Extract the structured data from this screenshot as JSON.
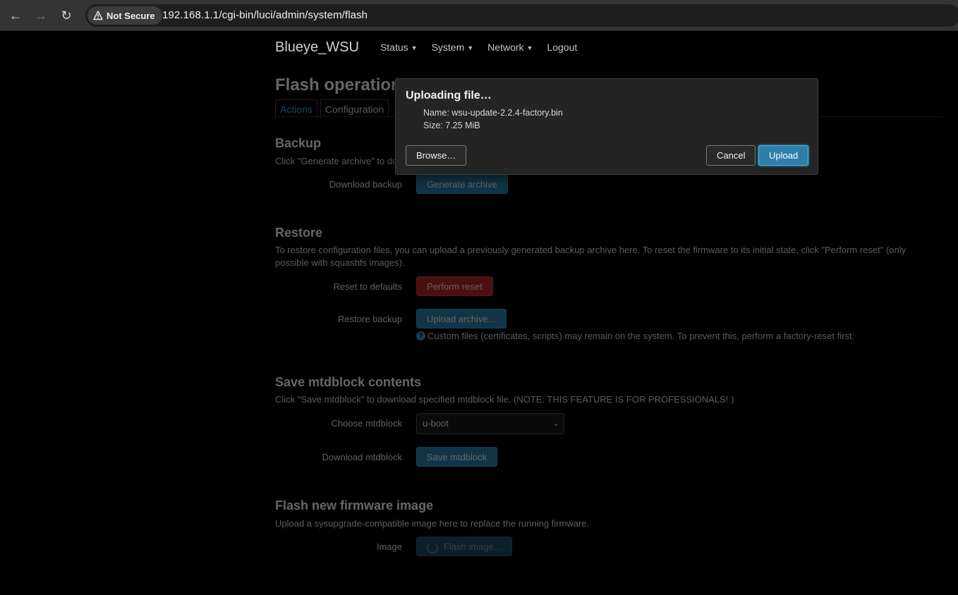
{
  "browser": {
    "security_label": "Not Secure",
    "url": "192.168.1.1/cgi-bin/luci/admin/system/flash"
  },
  "header": {
    "brand": "Blueye_WSU",
    "menu": [
      "Status",
      "System",
      "Network",
      "Logout"
    ]
  },
  "page": {
    "title": "Flash operations",
    "tabs": [
      "Actions",
      "Configuration"
    ]
  },
  "backup": {
    "title": "Backup",
    "desc": "Click \"Generate archive\" to download a tar archive of the current configuration files.",
    "label": "Download backup",
    "button": "Generate archive"
  },
  "restore": {
    "title": "Restore",
    "desc": "To restore configuration files, you can upload a previously generated backup archive here. To reset the firmware to its initial state, click \"Perform reset\" (only possible with squashfs images).",
    "reset_label": "Reset to defaults",
    "reset_button": "Perform reset",
    "restore_label": "Restore backup",
    "restore_button": "Upload archive...",
    "hint": "Custom files (certificates, scripts) may remain on the system. To prevent this, perform a factory-reset first."
  },
  "mtd": {
    "title": "Save mtdblock contents",
    "desc": "Click \"Save mtdblock\" to download specified mtdblock file. (NOTE: THIS FEATURE IS FOR PROFESSIONALS! )",
    "choose_label": "Choose mtdblock",
    "selected": "u-boot",
    "download_label": "Download mtdblock",
    "button": "Save mtdblock"
  },
  "firmware": {
    "title": "Flash new firmware image",
    "desc": "Upload a sysupgrade-compatible image here to replace the running firmware.",
    "label": "Image",
    "button": "Flash image..."
  },
  "modal": {
    "title": "Uploading file…",
    "name_line": "Name: wsu-update-2.2.4-factory.bin",
    "size_line": "Size: 7.25 MiB",
    "browse": "Browse…",
    "cancel": "Cancel",
    "upload": "Upload"
  },
  "colors": {
    "accent": "#2e7fa8",
    "danger": "#b02525"
  }
}
